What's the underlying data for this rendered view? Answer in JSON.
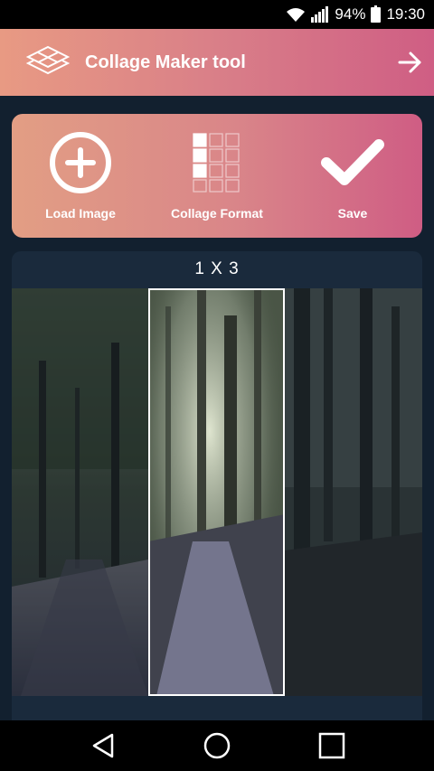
{
  "status_bar": {
    "battery_percent": "94%",
    "time": "19:30",
    "icons": [
      "wifi-icon",
      "signal-icon",
      "battery-icon"
    ]
  },
  "app_bar": {
    "title": "Collage Maker tool",
    "logo_icon": "stacked-diamond-logo-icon",
    "forward_icon": "arrow-right-icon"
  },
  "toolbar": {
    "load_image_label": "Load Image",
    "collage_format_label": "Collage Format",
    "save_label": "Save"
  },
  "preview": {
    "layout_label": "1 X 3",
    "selected_cell": 2,
    "cells": 3
  },
  "colors": {
    "accent_start": "#e89a83",
    "accent_end": "#cf5e84",
    "background": "#12202f",
    "panel": "#1a2a3c"
  },
  "nav_bar": {
    "icons": [
      "back-icon",
      "home-icon",
      "recents-icon"
    ]
  }
}
